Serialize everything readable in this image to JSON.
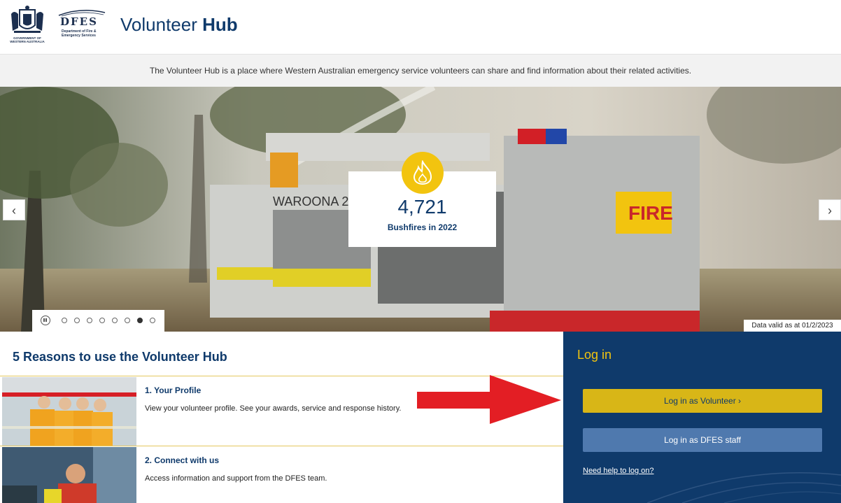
{
  "header": {
    "crest_text": "GOVERNMENT OF WESTERN AUSTRALIA",
    "dfes_abbrev": "DFES",
    "dfes_full": "Department of Fire & Emergency Services",
    "title_light": "Volunteer",
    "title_bold": "Hub"
  },
  "intro": {
    "text": "The Volunteer Hub is a place where Western Australian emergency service volunteers can share and find information about their related activities."
  },
  "hero": {
    "prev_label": "‹",
    "next_label": "›",
    "stat_value": "4,721",
    "stat_label": "Bushfires in 2022",
    "data_valid": "Data valid as at 01/2/2023",
    "slide_count": 8,
    "active_slide": 6,
    "truck_label_1": "WAROONA 2.4U",
    "truck_label_2": "FIRE"
  },
  "reasons": {
    "title": "5 Reasons to use the Volunteer Hub",
    "items": [
      {
        "title": "1. Your Profile",
        "desc": "View your volunteer profile. See your awards, service and response history."
      },
      {
        "title": "2. Connect with us",
        "desc": "Access information and support from the DFES team."
      }
    ]
  },
  "login": {
    "heading": "Log in",
    "volunteer_button": "Log in as Volunteer ›",
    "staff_button": "Log in as DFES staff",
    "help_link": "Need help to log on?"
  },
  "colors": {
    "navy": "#0f3a6b",
    "yellow": "#f2c40f",
    "volunteer_button": "#d8b617",
    "staff_button": "#4f79ae",
    "arrow": "#e31e24"
  }
}
